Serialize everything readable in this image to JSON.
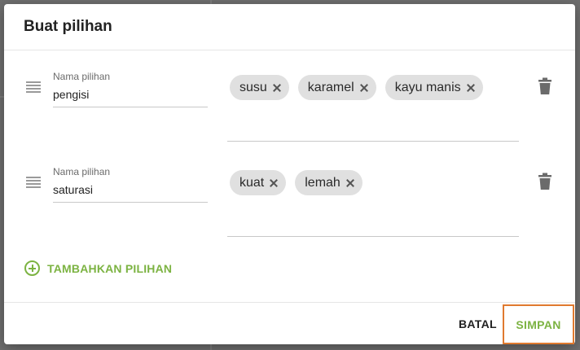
{
  "dialog": {
    "title": "Buat pilihan",
    "options": [
      {
        "name_label": "Nama pilihan",
        "name_value": "pengisi",
        "values": [
          "susu",
          "karamel",
          "kayu manis"
        ]
      },
      {
        "name_label": "Nama pilihan",
        "name_value": "saturasi",
        "values": [
          "kuat",
          "lemah"
        ]
      }
    ],
    "add_option_label": "TAMBAHKAN PILIHAN",
    "cancel_label": "BATAL",
    "save_label": "SIMPAN"
  },
  "icons": {
    "drag": "drag-handle-icon",
    "remove_chip": "close-icon",
    "delete": "trash-icon",
    "add": "plus-circle-icon"
  },
  "colors": {
    "accent": "#7cb342",
    "focus_outline": "#e07a2f",
    "chip_bg": "#e0e0e0"
  }
}
